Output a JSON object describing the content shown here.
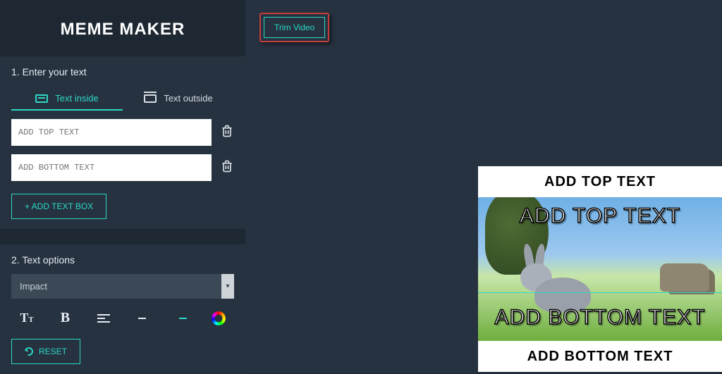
{
  "app_title": "MEME MAKER",
  "section1": {
    "title": "1. Enter your text",
    "tabs": {
      "inside": "Text inside",
      "outside": "Text outside"
    },
    "top_placeholder": "ADD TOP TEXT",
    "bottom_placeholder": "ADD BOTTOM TEXT",
    "add_box": "+ ADD TEXT BOX"
  },
  "section2": {
    "title": "2. Text options",
    "font_selected": "Impact",
    "reset": "RESET"
  },
  "trim": {
    "label": "Trim Video"
  },
  "preview": {
    "outer_top": "ADD TOP TEXT",
    "overlay_top": "ADD TOP TEXT",
    "overlay_bottom": "ADD BOTTOM TEXT",
    "outer_bottom": "ADD BOTTOM TEXT"
  }
}
